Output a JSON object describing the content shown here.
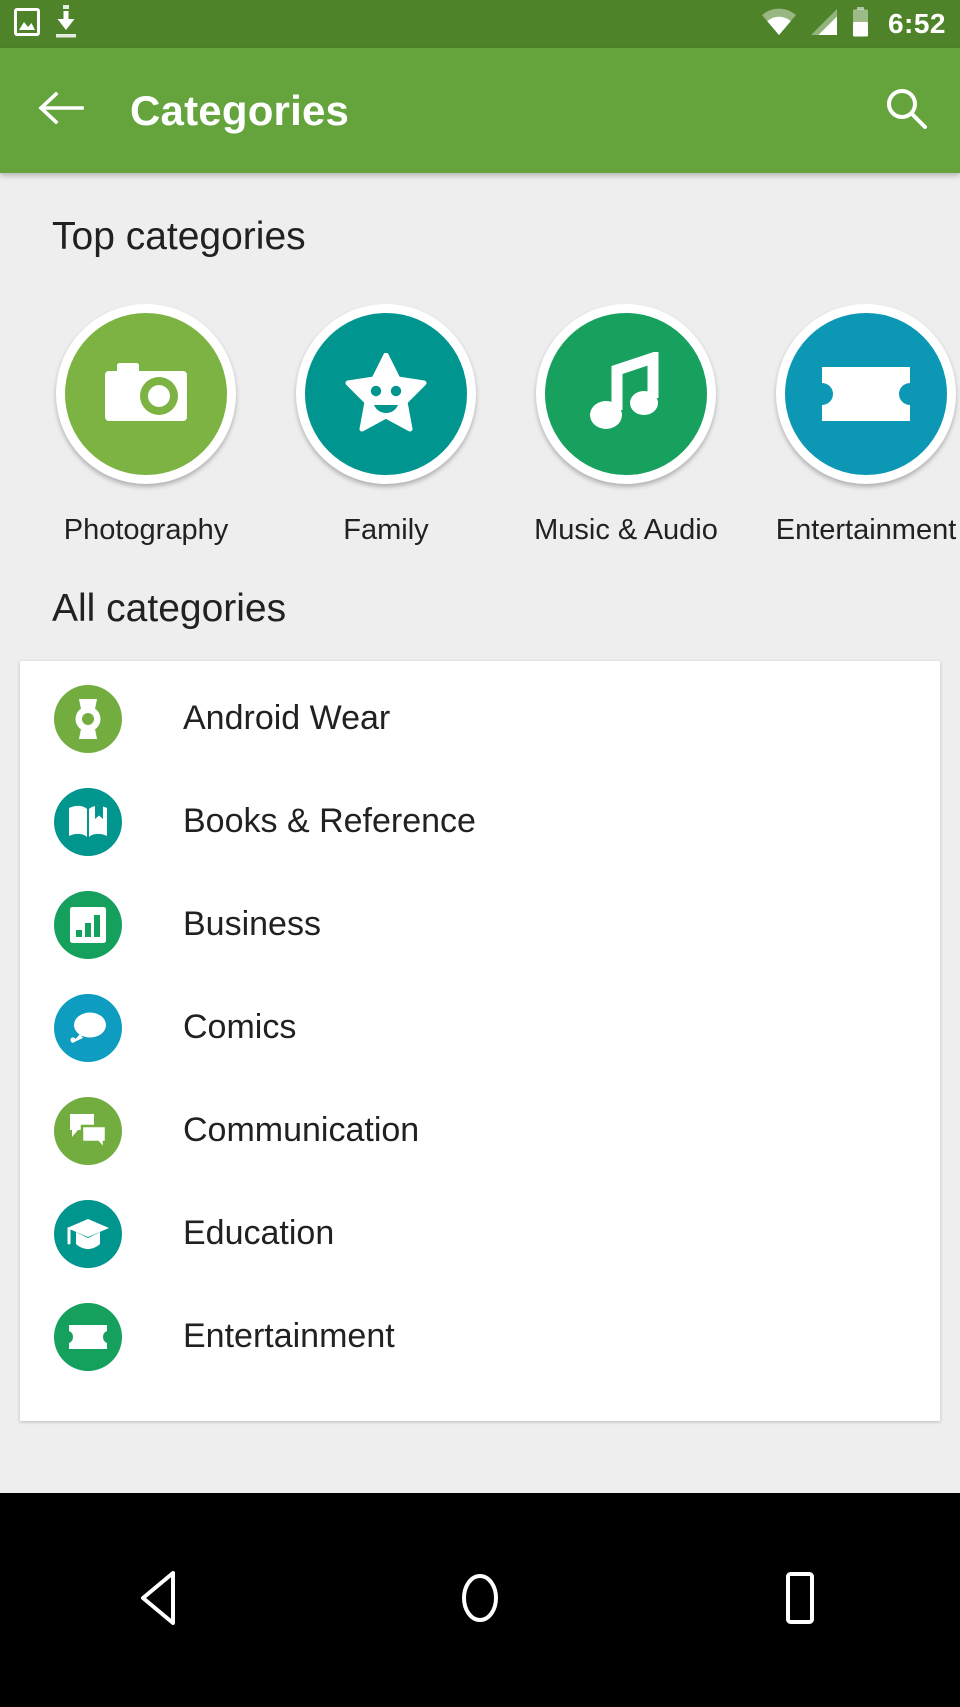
{
  "status_bar": {
    "background": "#4E8329",
    "time": "6:52",
    "left_icons": [
      {
        "name": "photo-icon",
        "label": "screenshot"
      },
      {
        "name": "download-icon",
        "label": "download"
      }
    ],
    "right_icons": [
      {
        "name": "wifi-icon",
        "label": "wifi"
      },
      {
        "name": "cellular-signal-icon",
        "label": "signal"
      },
      {
        "name": "battery-icon",
        "label": "battery"
      }
    ]
  },
  "toolbar": {
    "background": "#65A33D",
    "title": "Categories",
    "back_icon": "arrow-back-icon",
    "search_icon": "search-icon"
  },
  "page": {
    "background": "#EEEEEE",
    "card_background": "#FFFFFF"
  },
  "top_categories": {
    "heading": "Top categories",
    "items": [
      {
        "label": "Photography",
        "icon": "camera-icon",
        "color": "#7CB342"
      },
      {
        "label": "Family",
        "icon": "star-face-icon",
        "color": "#00968F"
      },
      {
        "label": "Music & Audio",
        "icon": "music-note-icon",
        "color": "#17A05E"
      },
      {
        "label": "Entertainment",
        "icon": "ticket-icon",
        "color": "#0C97B5"
      }
    ]
  },
  "all_categories": {
    "heading": "All categories",
    "items": [
      {
        "label": "Android Wear",
        "icon": "watch-icon",
        "color": "#73AD3F"
      },
      {
        "label": "Books & Reference",
        "icon": "book-icon",
        "color": "#00958D"
      },
      {
        "label": "Business",
        "icon": "bar-chart-icon",
        "color": "#15A05E"
      },
      {
        "label": "Comics",
        "icon": "speech-bubble-icon",
        "color": "#0E9CC0"
      },
      {
        "label": "Communication",
        "icon": "chat-bubbles-icon",
        "color": "#73AD3F"
      },
      {
        "label": "Education",
        "icon": "graduation-cap-icon",
        "color": "#00958D"
      },
      {
        "label": "Entertainment",
        "icon": "ticket-icon",
        "color": "#15A05E"
      }
    ]
  },
  "nav_bar": {
    "background": "#000000",
    "buttons": [
      {
        "name": "nav-back-button",
        "icon": "triangle-back-icon"
      },
      {
        "name": "nav-home-button",
        "icon": "circle-home-icon"
      },
      {
        "name": "nav-recents-button",
        "icon": "square-recents-icon"
      }
    ]
  }
}
